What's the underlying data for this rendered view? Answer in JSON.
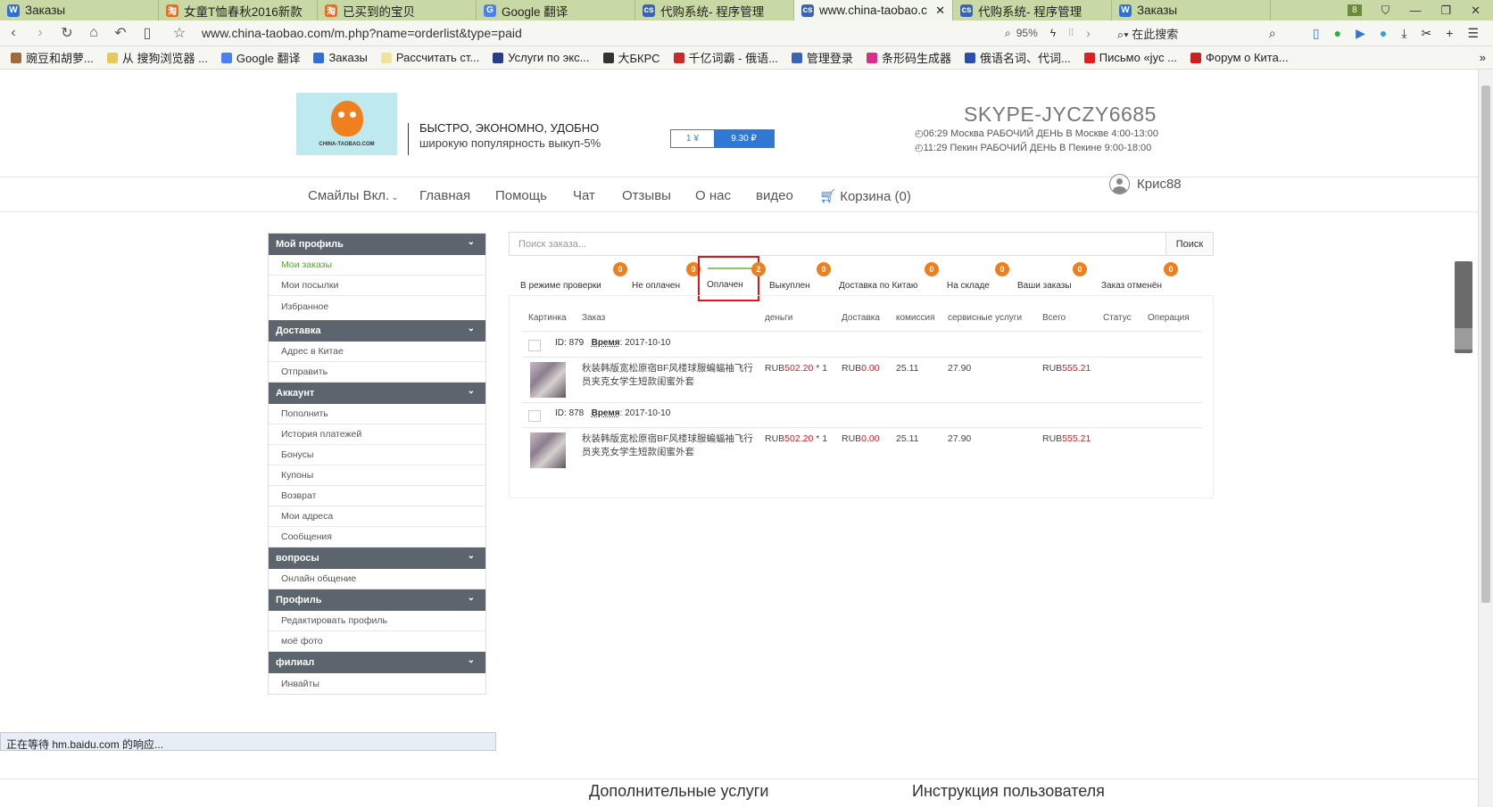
{
  "browser": {
    "tabs": [
      {
        "title": "Заказы",
        "fav": "W",
        "color": "#2f6fd6"
      },
      {
        "title": "女童T恤春秋2016新款",
        "fav": "淘",
        "color": "#e96b1e"
      },
      {
        "title": "已买到的宝贝",
        "fav": "淘",
        "color": "#e96b1e"
      },
      {
        "title": "Google 翻译",
        "fav": "G",
        "color": "#4a80f0"
      },
      {
        "title": "代购系统- 程序管理",
        "fav": "cs",
        "color": "#3a63b8"
      },
      {
        "title": "www.china-taobao.c",
        "fav": "cs",
        "color": "#3a63b8"
      },
      {
        "title": "代购系统- 程序管理",
        "fav": "cs",
        "color": "#3a63b8"
      },
      {
        "title": "Заказы",
        "fav": "W",
        "color": "#2f6fd6"
      }
    ],
    "tab_count": "8",
    "url": "www.china-taobao.com/m.php?name=orderlist&type=paid",
    "zoom": "95%",
    "search_placeholder": "在此搜索",
    "bookmarks": [
      {
        "label": "豌豆和胡萝...",
        "color": "#a26a3a"
      },
      {
        "label": "从 搜狗浏览器 ...",
        "color": "#e9c85a"
      },
      {
        "label": "Google 翻译",
        "color": "#4a80f0"
      },
      {
        "label": "Заказы",
        "color": "#2f6fd6"
      },
      {
        "label": "Рассчитать ст...",
        "color": "#f1e39b"
      },
      {
        "label": "Услуги по экс...",
        "color": "#2b3c8c"
      },
      {
        "label": "大БКРС",
        "color": "#333333"
      },
      {
        "label": "千亿词霸 - 俄语...",
        "color": "#cc2a2a"
      },
      {
        "label": "管理登录",
        "color": "#3a63b8"
      },
      {
        "label": "条形码生成器",
        "color": "#d92e8a"
      },
      {
        "label": "俄语名词、代词...",
        "color": "#2b4fb0"
      },
      {
        "label": "Письмо «jyc ...",
        "color": "#e0201d"
      },
      {
        "label": "Форум о Кита...",
        "color": "#cc1f1f"
      }
    ],
    "status": "正在等待 hm.baidu.com 的响应..."
  },
  "header": {
    "logo_text": "CHINA-TAOBAO.COM",
    "slogan1": "БЫСТРО, ЭКОНОМНО, УДОБНО",
    "slogan2": "широкую популярность выкуп-5%",
    "rate_left": "1 ¥",
    "rate_right": "9.30 ₽",
    "skype": "SKYPE-JYCZY6685",
    "work1": "◴06:29  Москва  РАБОЧИЙ ДЕНЬ В Москве 4:00-13:00",
    "work2": "◴11:29  Пекин   РАБОЧИЙ ДЕНЬ В Пекине 9:00-18:00"
  },
  "nav": {
    "smiles": "Смайлы Вкл.",
    "home": "Главная",
    "help": "Помощь",
    "chat": "Чат",
    "reviews": "Отзывы",
    "about": "О нас",
    "video": "видео",
    "cart": "Корзина (0)",
    "user": "Крис88"
  },
  "sidebar": [
    {
      "header": "Мой профиль",
      "items": [
        "Мои заказы",
        "Мои посылки",
        "Избранное"
      ]
    },
    {
      "header": "Доставка",
      "items": [
        "Адрес в Китае",
        "Отправить"
      ]
    },
    {
      "header": "Аккаунт",
      "items": [
        "Пополнить",
        "История платежей",
        "Бонусы",
        "Купоны",
        "Возврат",
        "Мои адреса",
        "Сообщения"
      ]
    },
    {
      "header": "вопросы",
      "items": [
        "Онлайн общение"
      ]
    },
    {
      "header": "Профиль",
      "items": [
        "Редактировать профиль",
        "моё фото"
      ]
    },
    {
      "header": "филиал",
      "items": [
        "Инвайты"
      ]
    }
  ],
  "search": {
    "placeholder": "Поиск заказа...",
    "button": "Поиск"
  },
  "status_tabs": [
    {
      "label": "В режиме проверки",
      "count": "0"
    },
    {
      "label": "Не оплачен",
      "count": "0"
    },
    {
      "label": "Оплачен",
      "count": "2"
    },
    {
      "label": "Выкуплен",
      "count": "0"
    },
    {
      "label": "Доставка по Китаю",
      "count": "0"
    },
    {
      "label": "На складе",
      "count": "0"
    },
    {
      "label": "Ваши заказы",
      "count": "0"
    },
    {
      "label": "Заказ отменён",
      "count": "0"
    }
  ],
  "table": {
    "headers": [
      "Картинка",
      "Заказ",
      "деньги",
      "Доставка",
      "комиссия",
      "сервисные услуги",
      "Всего",
      "Статус",
      "Операция"
    ],
    "orders": [
      {
        "id_label": "ID:",
        "id": "879",
        "time_label": "Время",
        "time": ": 2017-10-10",
        "product": "秋装韩版宽松原宿BF风楼球服蝙蝠袖飞行员夹克女学生短款闺蜜外套",
        "money_cur": "RUB",
        "money_val": "502.20",
        "qty": " * 1",
        "ship_cur": "RUB",
        "ship_val": "0.00",
        "commission": "25.11",
        "service": "27.90",
        "total_cur": "RUB",
        "total_val": "555.21"
      },
      {
        "id_label": "ID:",
        "id": "878",
        "time_label": "Время",
        "time": ": 2017-10-10",
        "product": "秋装韩版宽松原宿BF风楼球服蝙蝠袖飞行员夹克女学生短款闺蜜外套",
        "money_cur": "RUB",
        "money_val": "502.20",
        "qty": " * 1",
        "ship_cur": "RUB",
        "ship_val": "0.00",
        "commission": "25.11",
        "service": "27.90",
        "total_cur": "RUB",
        "total_val": "555.21"
      }
    ]
  },
  "footer": {
    "col1": "Дополнительные услуги",
    "col2": "Инструкция пользователя"
  }
}
